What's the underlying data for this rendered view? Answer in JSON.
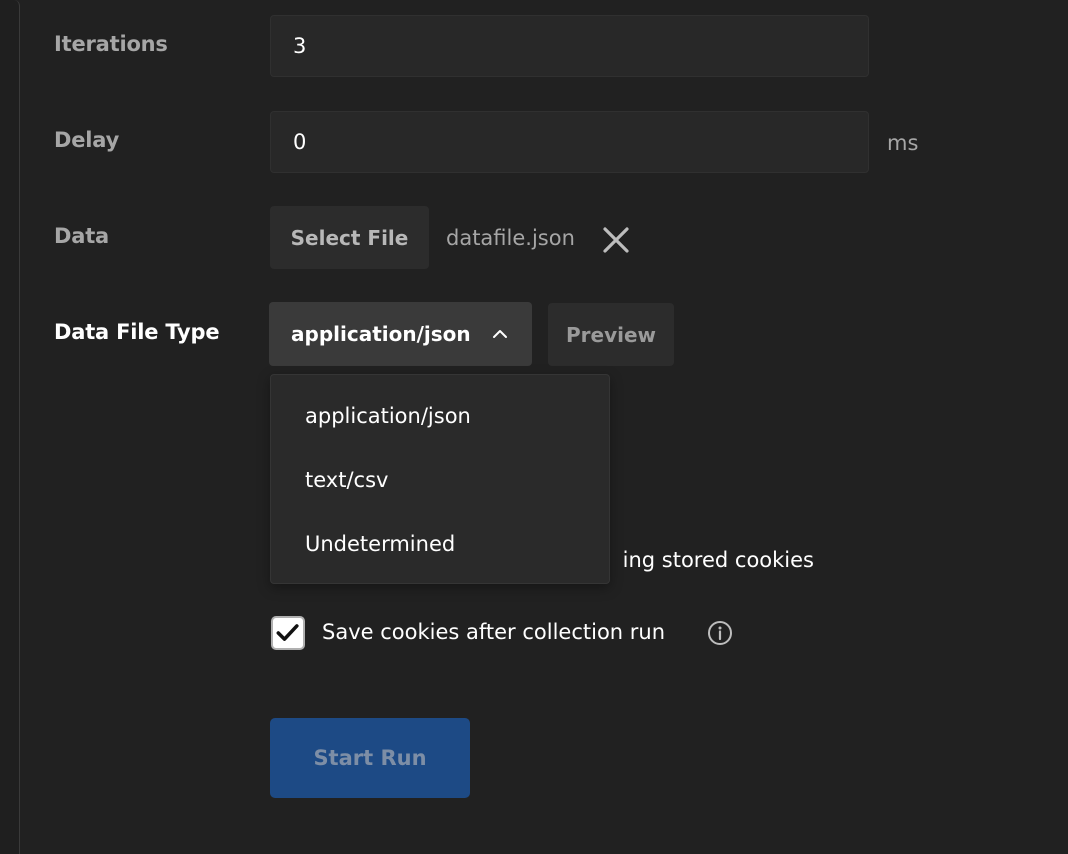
{
  "iterations": {
    "label": "Iterations",
    "value": "3"
  },
  "delay": {
    "label": "Delay",
    "value": "0",
    "unit": "ms"
  },
  "data": {
    "label": "Data",
    "select_file_label": "Select File",
    "file_name": "datafile.json"
  },
  "data_file_type": {
    "label": "Data File Type",
    "selected": "application/json",
    "preview_label": "Preview",
    "options": [
      "application/json",
      "text/csv",
      "Undetermined"
    ]
  },
  "cookies": {
    "persist_label_partial": "ing stored cookies",
    "save_label": "Save cookies after collection run",
    "save_checked": true
  },
  "start_run_label": "Start Run",
  "colors": {
    "background": "#212121",
    "input": "#282828",
    "select": "#3a3a3a",
    "primary_button_disabled": "#1d4a85"
  }
}
